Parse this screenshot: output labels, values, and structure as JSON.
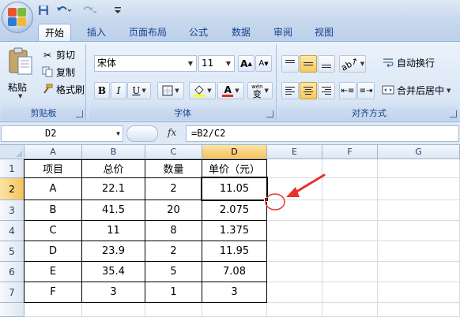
{
  "title_bar": {
    "quick_access": [
      "save-icon",
      "undo-icon",
      "redo-icon",
      "customize-qat-icon"
    ]
  },
  "tabs": [
    {
      "label": "开始",
      "active": true
    },
    {
      "label": "插入"
    },
    {
      "label": "页面布局"
    },
    {
      "label": "公式"
    },
    {
      "label": "数据"
    },
    {
      "label": "审阅"
    },
    {
      "label": "视图"
    }
  ],
  "ribbon": {
    "clipboard": {
      "paste_label": "粘贴",
      "cut_label": "剪切",
      "copy_label": "复制",
      "format_painter_label": "格式刷",
      "group_label": "剪贴板"
    },
    "font": {
      "font_name": "宋体",
      "font_size": "11",
      "grow_label": "A",
      "shrink_label": "A",
      "bold": "B",
      "italic": "I",
      "underline": "U",
      "font_color_glyph": "A",
      "phonetic_glyph": "wén",
      "phonetic_char": "变",
      "group_label": "字体"
    },
    "alignment": {
      "wrap_text_label": "自动换行",
      "merge_center_label": "合并后居中",
      "group_label": "对齐方式"
    }
  },
  "formula_bar": {
    "name_box": "D2",
    "fx_label": "fx",
    "formula": "=B2/C2"
  },
  "sheet": {
    "columns": [
      "A",
      "B",
      "C",
      "D",
      "E",
      "F",
      "G"
    ],
    "active_column": "D",
    "rows": [
      "1",
      "2",
      "3",
      "4",
      "5",
      "6",
      "7"
    ],
    "active_row": "2",
    "active_cell": "D2",
    "cells": [
      [
        "项目",
        "总价",
        "数量",
        "单价（元）"
      ],
      [
        "A",
        "22.1",
        "2",
        "11.05"
      ],
      [
        "B",
        "41.5",
        "20",
        "2.075"
      ],
      [
        "C",
        "11",
        "8",
        "1.375"
      ],
      [
        "D",
        "23.9",
        "2",
        "11.95"
      ],
      [
        "E",
        "35.4",
        "5",
        "7.08"
      ],
      [
        "F",
        "3",
        "1",
        "3"
      ]
    ]
  },
  "annotation": {
    "color": "#e8322a"
  }
}
